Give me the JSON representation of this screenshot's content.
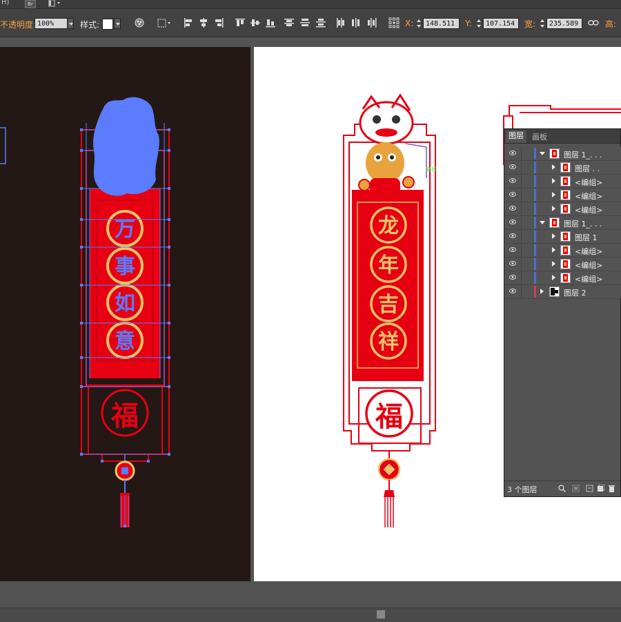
{
  "appbar": {
    "frag": "H)",
    "bridge_label": "Br"
  },
  "control_bar": {
    "opacity_label": "不透明度:",
    "opacity_value": "100%",
    "style_label": "样式:",
    "x_label": "X:",
    "x_value": "148.511",
    "y_label": "Y:",
    "y_value": "107.154",
    "w_label": "宽:",
    "w_value": "235.589",
    "h_label": "高:"
  },
  "artwork": {
    "left_chars": [
      "万",
      "事",
      "如",
      "意"
    ],
    "right_chars": [
      "龙",
      "年",
      "吉",
      "祥"
    ],
    "fu": "福"
  },
  "canvas": {
    "selection_tag": "路径"
  },
  "layers_panel": {
    "tabs": [
      "图层",
      "画板"
    ],
    "rows": [
      {
        "name": "图层 1_. . .",
        "level": 0,
        "expanded": true
      },
      {
        "name": "图层 . .",
        "level": 1,
        "expanded": false
      },
      {
        "name": "<编组>",
        "level": 1,
        "expanded": false
      },
      {
        "name": "<编组>",
        "level": 1,
        "expanded": false
      },
      {
        "name": "<编组>",
        "level": 1,
        "expanded": false
      },
      {
        "name": "图层 1_. . .",
        "level": 0,
        "expanded": true
      },
      {
        "name": "图层 1",
        "level": 1,
        "expanded": false
      },
      {
        "name": "<编组>",
        "level": 1,
        "expanded": false
      },
      {
        "name": "<编组>",
        "level": 1,
        "expanded": false
      },
      {
        "name": "<编组>",
        "level": 1,
        "expanded": false
      },
      {
        "name": "图层 2",
        "level": 0,
        "expanded": false
      }
    ],
    "footer_count": "3 个图层"
  },
  "colors": {
    "red": "#e60012",
    "gold": "#f2c36b",
    "selection_blue": "#5b7cff",
    "dark_artboard": "#231815",
    "label_orange": "#ffa043"
  }
}
